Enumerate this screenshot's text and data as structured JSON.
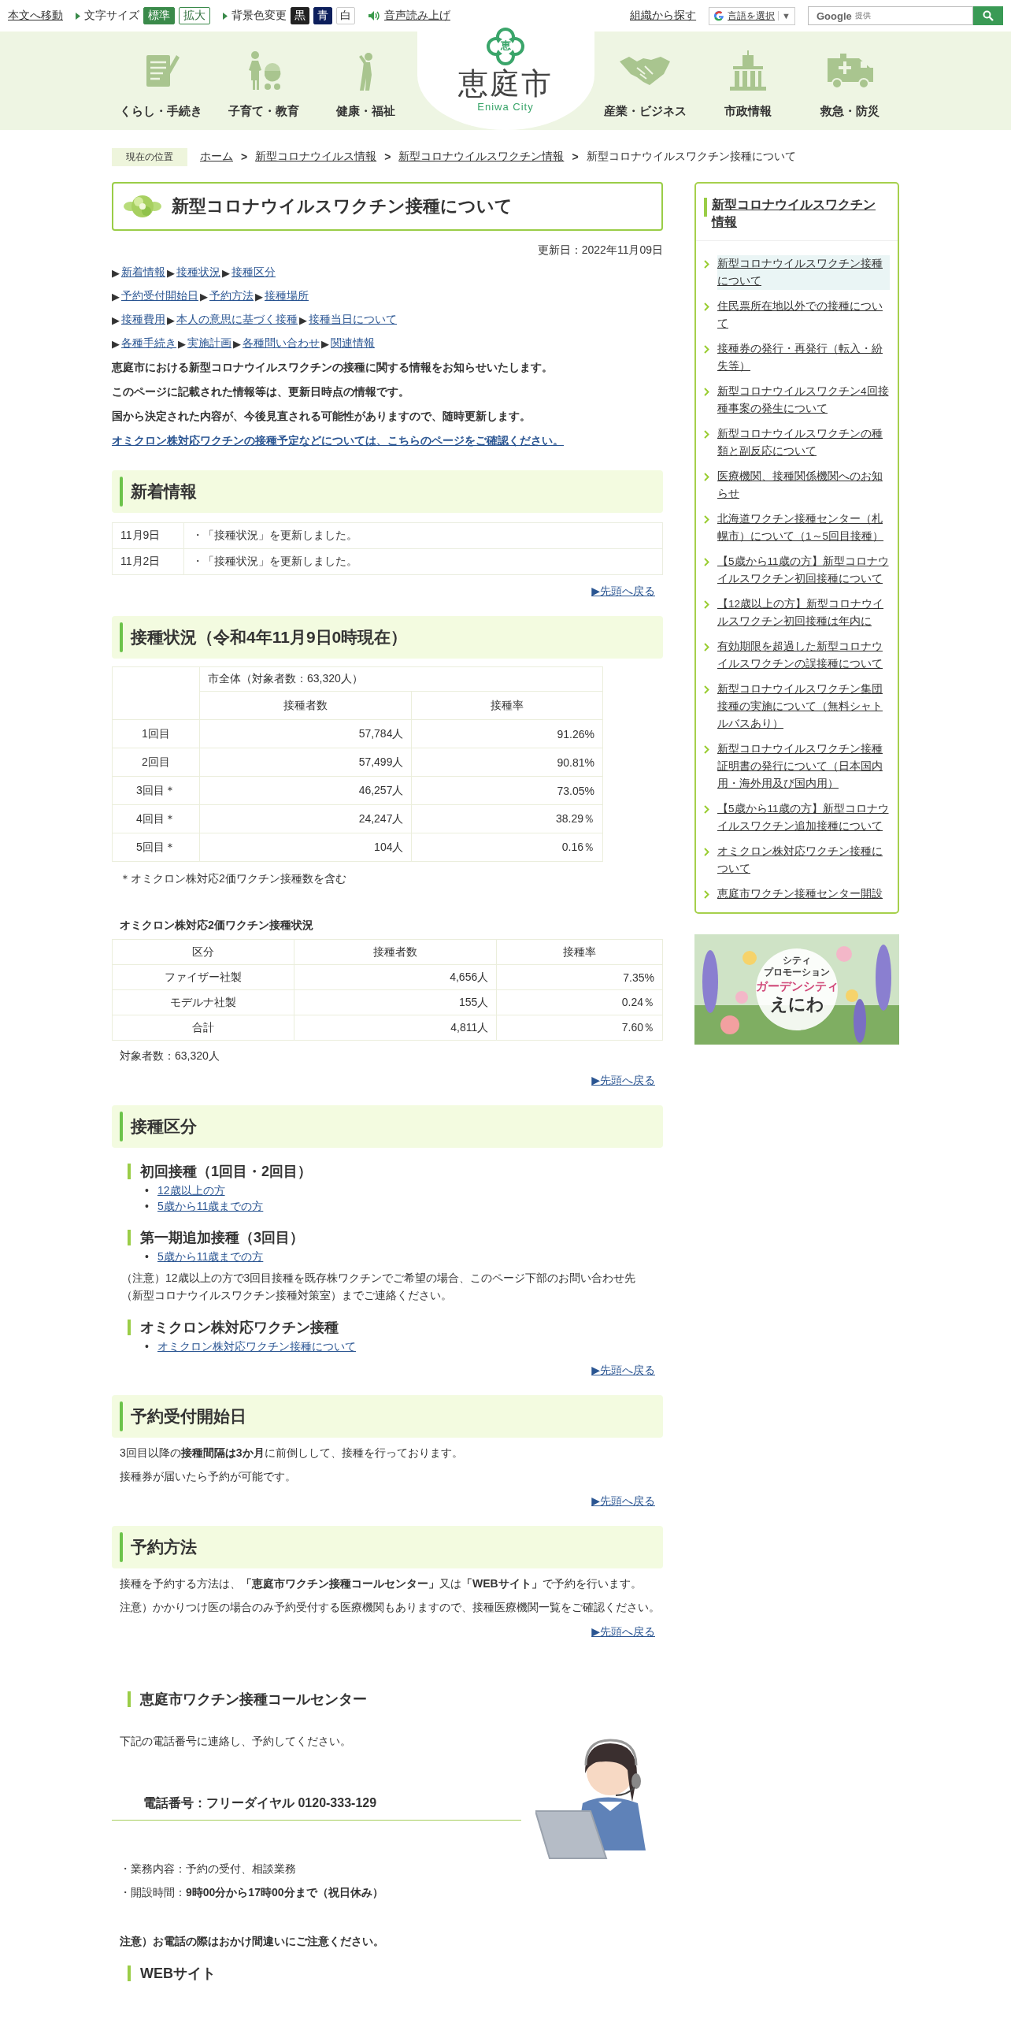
{
  "top_bar": {
    "skip_link": "本文へ移動",
    "font_size": {
      "label": "文字サイズ",
      "options": [
        {
          "label": "標準",
          "selected": true
        },
        {
          "label": "拡大",
          "selected": false
        }
      ]
    },
    "bg_color": {
      "label": "背景色変更",
      "options": [
        {
          "label": "黒",
          "kind": "black"
        },
        {
          "label": "青",
          "kind": "navy"
        },
        {
          "label": "白",
          "kind": "white"
        }
      ]
    },
    "read_aloud": "音声読み上げ",
    "org_search": "組織から探す",
    "translate": {
      "label": "言語を選択",
      "caret": "▼"
    },
    "search": {
      "brand": "Google",
      "suffix": "提供"
    }
  },
  "nav": {
    "logo": {
      "mark": "恵",
      "name": "恵庭市",
      "sub": "Eniwa City"
    },
    "left": [
      {
        "label": "くらし・手続き",
        "kind": "document"
      },
      {
        "label": "子育て・教育",
        "kind": "parenting"
      },
      {
        "label": "健康・福祉",
        "kind": "health"
      }
    ],
    "right": [
      {
        "label": "産業・ビジネス",
        "kind": "business"
      },
      {
        "label": "市政情報",
        "kind": "government"
      },
      {
        "label": "救急・防災",
        "kind": "emergency"
      }
    ]
  },
  "breadcrumb": {
    "label": "現在の位置",
    "separator": ">",
    "items": [
      "ホーム",
      "新型コロナウイルス情報",
      "新型コロナウイルスワクチン情報"
    ],
    "current": "新型コロナウイルスワクチン接種について"
  },
  "page": {
    "title": "新型コロナウイルスワクチン接種について",
    "updated": "更新日：2022年11月09日"
  },
  "main": [
    {
      "kind": "anchors",
      "marker": "▶",
      "rows": [
        [
          "新着情報",
          "接種状況",
          "接種区分"
        ],
        [
          "予約受付開始日",
          "予約方法",
          "接種場所"
        ],
        [
          "接種費用",
          "本人の意思に基づく接種",
          "接種当日について"
        ],
        [
          "各種手続き",
          "実施計画",
          "各種問い合わせ",
          "関連情報"
        ]
      ]
    },
    {
      "kind": "lead",
      "text": "恵庭市における新型コロナウイルスワクチンの接種に関する情報をお知らせいたします。"
    },
    {
      "kind": "lead",
      "text": "このページに記載された情報等は、更新日時点の情報です。"
    },
    {
      "kind": "lead",
      "text": "国から決定された内容が、今後見直される可能性がありますので、随時更新します。"
    },
    {
      "kind": "link",
      "text": "オミクロン株対応ワクチンの接種予定などについては、こちらのページをご確認ください。"
    },
    {
      "kind": "h2",
      "text": "新着情報"
    },
    {
      "kind": "news",
      "rows": [
        {
          "date": "11月9日",
          "text": "・「接種状況」を更新しました。"
        },
        {
          "date": "11月2日",
          "text": "・「接種状況」を更新しました。"
        }
      ]
    },
    {
      "kind": "back",
      "text": "▶先頭へ戻る"
    },
    {
      "kind": "h2",
      "text": "接種状況（令和4年11月9日0時現在）"
    },
    {
      "kind": "status_table",
      "group_header": "市全体（対象者数：63,320人）",
      "columns": [
        "接種者数",
        "接種率"
      ],
      "rows": [
        {
          "label": "1回目",
          "count": "57,784人",
          "rate": "91.26%"
        },
        {
          "label": "2回目",
          "count": "57,499人",
          "rate": "90.81%"
        },
        {
          "label": "3回目＊",
          "count": "46,257人",
          "rate": "73.05%"
        },
        {
          "label": "4回目＊",
          "count": "24,247人",
          "rate": "38.29％"
        },
        {
          "label": "5回目＊",
          "count": "104人",
          "rate": "0.16％"
        }
      ]
    },
    {
      "kind": "note",
      "text": "＊オミクロン株対応2価ワクチン接種数を含む"
    },
    {
      "kind": "subtitle",
      "text": "オミクロン株対応2価ワクチン接種状況"
    },
    {
      "kind": "table",
      "columns": [
        "区分",
        "接種者数",
        "接種率"
      ],
      "rows": [
        [
          "ファイザー社製",
          "4,656人",
          "7.35%"
        ],
        [
          "モデルナ社製",
          "155人",
          "0.24％"
        ],
        [
          "合計",
          "4,811人",
          "7.60％"
        ]
      ]
    },
    {
      "kind": "paragraph",
      "text": "対象者数：63,320人"
    },
    {
      "kind": "back",
      "text": "▶先頭へ戻る"
    },
    {
      "kind": "h2",
      "text": "接種区分"
    },
    {
      "kind": "h3",
      "text": "初回接種（1回目・2回目）"
    },
    {
      "kind": "bullets",
      "marker": "•",
      "items": [
        "12歳以上の方",
        "5歳から11歳までの方"
      ]
    },
    {
      "kind": "h3",
      "text": "第一期追加接種（3回目）"
    },
    {
      "kind": "bullets",
      "marker": "•",
      "items": [
        "5歳から11歳までの方"
      ]
    },
    {
      "kind": "indent",
      "text": "（注意）12歳以上の方で3回目接種を既存株ワクチンでご希望の場合、このページ下部のお問い合わせ先（新型コロナウイルスワクチン接種対策室）までご連絡ください。"
    },
    {
      "kind": "h3",
      "text": "オミクロン株対応ワクチン接種"
    },
    {
      "kind": "bullets",
      "marker": "•",
      "items": [
        "オミクロン株対応ワクチン接種について"
      ]
    },
    {
      "kind": "back",
      "text": "▶先頭へ戻る"
    },
    {
      "kind": "h2",
      "text": "予約受付開始日"
    },
    {
      "kind": "alert",
      "text": "3回目以降の**接種間隔は3か月**に前倒しして、接種を行っております。"
    },
    {
      "kind": "paragraph",
      "text": "接種券が届いたら予約が可能です。"
    },
    {
      "kind": "back",
      "text": "▶先頭へ戻る"
    },
    {
      "kind": "h2",
      "text": "予約方法"
    },
    {
      "kind": "paragraph",
      "text": "接種を予約する方法は、**「恵庭市ワクチン接種コールセンター」**又は**「WEBサイト」**で予約を行います。"
    },
    {
      "kind": "paragraph",
      "text": "注意）かかりつけ医の場合のみ予約受付する医療機関もありますので、接種医療機関一覧をご確認ください。"
    },
    {
      "kind": "back",
      "text": "▶先頭へ戻る"
    },
    {
      "kind": "h3",
      "text": "恵庭市ワクチン接種コールセンター"
    },
    {
      "kind": "contact",
      "intro": "下記の電話番号に連絡し、予約してください。",
      "phone": "電話番号：フリーダイヤル 0120-333-129",
      "details": [
        "・業務内容：予約の受付、相談業務",
        "・開設時間：**9時00分から17時00分まで（祝日休み）**"
      ]
    },
    {
      "kind": "strong",
      "text": "注意）お電話の際はおかけ間違いにご注意ください。"
    },
    {
      "kind": "h3",
      "text": "WEBサイト"
    }
  ],
  "sidebar": {
    "title": "新型コロナウイルスワクチン情報",
    "items": [
      {
        "text": "新型コロナウイルスワクチン接種について",
        "selected": true
      },
      {
        "text": "住民票所在地以外での接種について",
        "selected": false
      },
      {
        "text": "接種券の発行・再発行（転入・紛失等）",
        "selected": false
      },
      {
        "text": "新型コロナウイルスワクチン4回接種事案の発生について",
        "selected": false
      },
      {
        "text": "新型コロナウイルスワクチンの種類と副反応について",
        "selected": false
      },
      {
        "text": "医療機関、接種関係機関へのお知らせ",
        "selected": false
      },
      {
        "text": "北海道ワクチン接種センター（札幌市）について（1～5回目接種）",
        "selected": false
      },
      {
        "text": "【5歳から11歳の方】新型コロナウイルスワクチン初回接種について",
        "selected": false
      },
      {
        "text": "【12歳以上の方】新型コロナウイルスワクチン初回接種は年内に",
        "selected": false
      },
      {
        "text": "有効期限を超過した新型コロナウイルスワクチンの誤接種について",
        "selected": false
      },
      {
        "text": "新型コロナウイルスワクチン集団接種の実施について（無料シャトルバスあり）",
        "selected": false
      },
      {
        "text": "新型コロナウイルスワクチン接種証明書の発行について（日本国内用・海外用及び国内用）",
        "selected": false
      },
      {
        "text": "【5歳から11歳の方】新型コロナウイルスワクチン追加接種について",
        "selected": false
      },
      {
        "text": "オミクロン株対応ワクチン接種について",
        "selected": false
      },
      {
        "text": "恵庭市ワクチン接種センター開設",
        "selected": false
      }
    ],
    "banner": {
      "kind": "picture",
      "small": [
        "シティ",
        "プロモーション"
      ],
      "title": "ガーデンシティ",
      "city": "えにわ"
    }
  }
}
